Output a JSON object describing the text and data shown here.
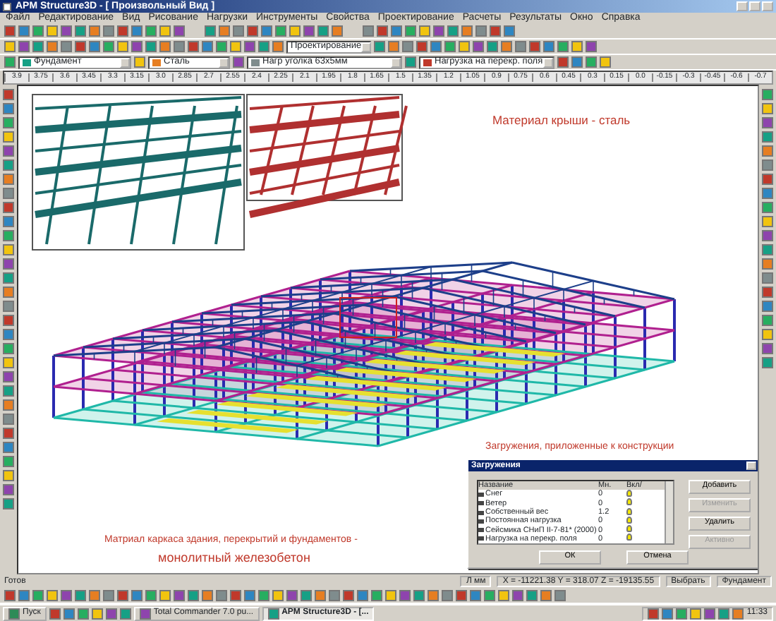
{
  "window": {
    "title": "APM Structure3D - [ Произвольный Вид ]"
  },
  "menu": [
    "Файл",
    "Редактирование",
    "Вид",
    "Рисование",
    "Нагрузки",
    "Инструменты",
    "Свойства",
    "Проектирование",
    "Расчеты",
    "Результаты",
    "Окно",
    "Справка"
  ],
  "mode_combo": {
    "value": "Проектирование"
  },
  "property_combos": [
    {
      "value": "Фундамент"
    },
    {
      "value": "Сталь"
    },
    {
      "value": "Нагр уголка 63х5мм"
    },
    {
      "value": "Нагрузка на перекр. поля"
    }
  ],
  "ruler": {
    "ticks": [
      "3.9",
      "3.75",
      "3.6",
      "3.45",
      "3.3",
      "3.15",
      "3.0",
      "2.85",
      "2.7",
      "2.55",
      "2.4",
      "2.25",
      "2.1",
      "1.95",
      "1.8",
      "1.65",
      "1.5",
      "1.35",
      "1.2",
      "1.05",
      "0.9",
      "0.75",
      "0.6",
      "0.45",
      "0.3",
      "0.15",
      "0.0",
      "-0.15",
      "-0.3",
      "-0.45",
      "-0.6",
      "-0.7"
    ]
  },
  "annotations": [
    {
      "text": "Материал крыши  - сталь"
    },
    {
      "text": "Загружения, приложенные к конструкции"
    },
    {
      "text": "Матриал каркаса здания, перекрытий и фундаментов -"
    },
    {
      "text": "монолитный железобетон"
    }
  ],
  "dialog": {
    "title": "Загружения",
    "columns": [
      "Название",
      "Мн.",
      "Вкл/"
    ],
    "rows": [
      {
        "name": "Снег",
        "factor": "0",
        "on": true
      },
      {
        "name": "Ветер",
        "factor": "0",
        "on": true
      },
      {
        "name": "Собственный вес",
        "factor": "1.2",
        "on": true
      },
      {
        "name": "Постоянная нагрузка",
        "factor": "0",
        "on": true
      },
      {
        "name": "Сейсмика СНиП II-7-81* (2000)",
        "factor": "0",
        "on": true
      },
      {
        "name": "Нагрузка на перекр. поля",
        "factor": "0",
        "on": true
      }
    ],
    "side_buttons": [
      {
        "label": "Добавить",
        "disabled": false
      },
      {
        "label": "Изменить",
        "disabled": true
      },
      {
        "label": "Удалить",
        "disabled": false
      },
      {
        "label": "Активно",
        "disabled": true
      }
    ],
    "buttons": [
      "ОК",
      "Отмена"
    ]
  },
  "status_bar": {
    "state": "Готов",
    "units": "Л мм",
    "coords": "X = -11221.38 Y = 318.07 Z = -19135.55",
    "mode": "Выбрать",
    "material": "Фундамент"
  },
  "taskbar": {
    "start": "Пуск",
    "windows": [
      {
        "label": "Total Commander 7.0 pu...",
        "selected": false
      },
      {
        "label": "APM Structure3D - [...",
        "selected": true
      }
    ],
    "clock": "11:33"
  }
}
